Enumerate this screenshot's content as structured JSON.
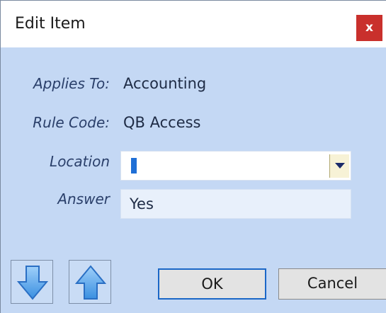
{
  "window": {
    "title": "Edit Item",
    "close_glyph": "x"
  },
  "form": {
    "applies_to_label": "Applies To:",
    "applies_to_value": "Accounting",
    "rule_code_label": "Rule Code:",
    "rule_code_value": "QB Access",
    "location_label": "Location",
    "location_value": "",
    "answer_label": "Answer",
    "answer_value": "Yes"
  },
  "buttons": {
    "move_down_icon": "arrow-down-icon",
    "move_up_icon": "arrow-up-icon",
    "ok_label": "OK",
    "cancel_label": "Cancel"
  },
  "colors": {
    "dialog_background": "#c4d8f4",
    "close_button": "#c9302c",
    "ok_border": "#1b67c7",
    "arrow_fill": "#5aa8e8"
  }
}
